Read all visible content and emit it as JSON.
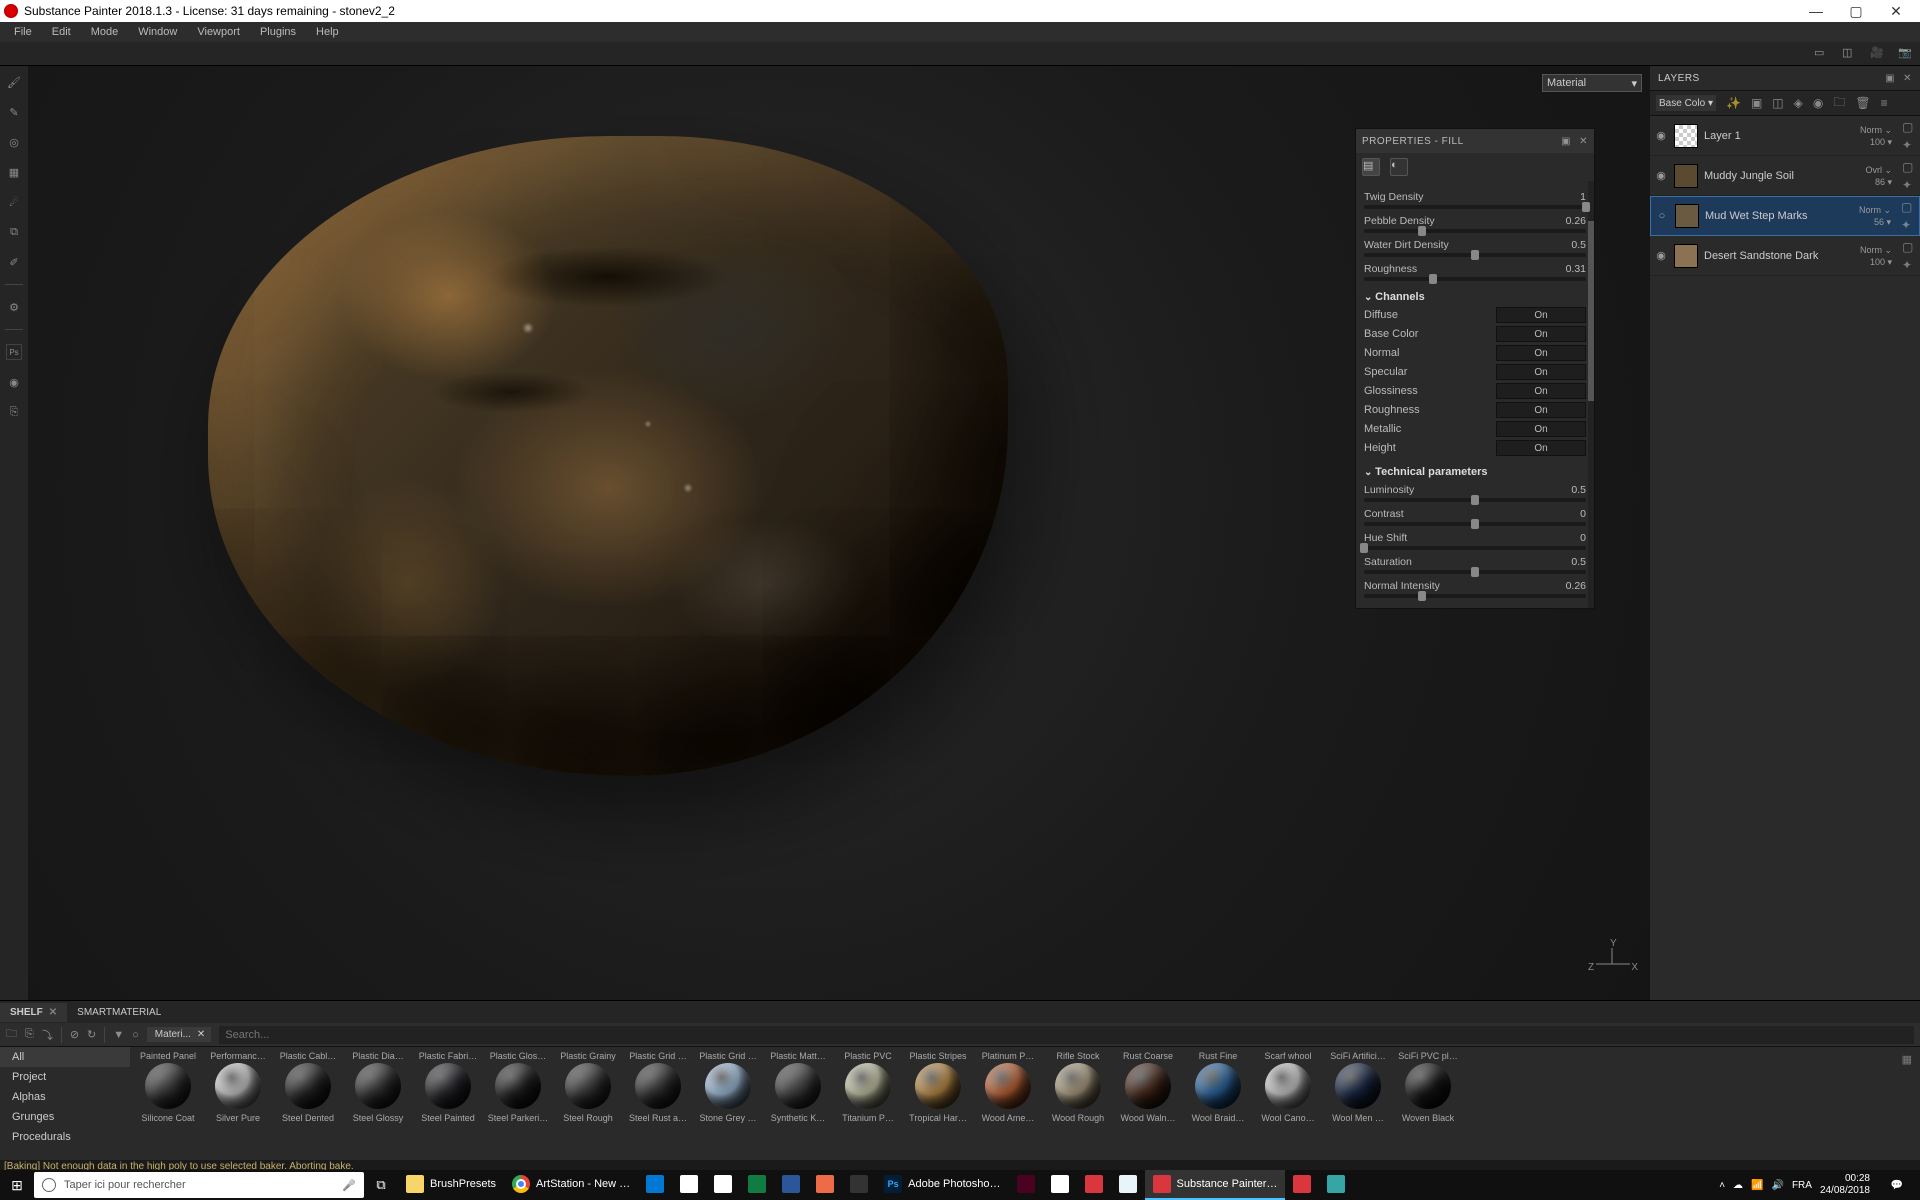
{
  "title": "Substance Painter 2018.1.3 - License: 31 days remaining - stonev2_2",
  "menu": [
    "File",
    "Edit",
    "Mode",
    "Window",
    "Viewport",
    "Plugins",
    "Help"
  ],
  "viewport": {
    "mode": "Material",
    "axes": {
      "x": "X",
      "y": "Y",
      "z": "Z"
    }
  },
  "properties": {
    "title": "PROPERTIES - FILL",
    "sliders": [
      {
        "label": "Twig Density",
        "value": "1",
        "pos": 100
      },
      {
        "label": "Pebble Density",
        "value": "0.26",
        "pos": 26
      },
      {
        "label": "Water Dirt Density",
        "value": "0.5",
        "pos": 50
      },
      {
        "label": "Roughness",
        "value": "0.31",
        "pos": 31
      }
    ],
    "channels_h": "Channels",
    "channels": [
      {
        "label": "Diffuse",
        "state": "On"
      },
      {
        "label": "Base Color",
        "state": "On"
      },
      {
        "label": "Normal",
        "state": "On"
      },
      {
        "label": "Specular",
        "state": "On"
      },
      {
        "label": "Glossiness",
        "state": "On"
      },
      {
        "label": "Roughness",
        "state": "On"
      },
      {
        "label": "Metallic",
        "state": "On"
      },
      {
        "label": "Height",
        "state": "On"
      }
    ],
    "tech_h": "Technical parameters",
    "tech": [
      {
        "label": "Luminosity",
        "value": "0.5",
        "pos": 50
      },
      {
        "label": "Contrast",
        "value": "0",
        "pos": 50
      },
      {
        "label": "Hue Shift",
        "value": "0",
        "pos": 0
      },
      {
        "label": "Saturation",
        "value": "0.5",
        "pos": 50
      },
      {
        "label": "Normal Intensity",
        "value": "0.26",
        "pos": 26
      }
    ]
  },
  "layers": {
    "title": "LAYERS",
    "channel_sel": "Base Colo",
    "items": [
      {
        "name": "Layer 1",
        "blend": "Norm",
        "opacity": "100",
        "thumb": "#eee",
        "checker": true
      },
      {
        "name": "Muddy Jungle Soil",
        "blend": "Ovrl",
        "opacity": "86",
        "thumb": "#5a4a32"
      },
      {
        "name": "Mud Wet Step Marks",
        "blend": "Norm",
        "opacity": "56",
        "thumb": "#6b5a42",
        "selected": true,
        "eyeoff": true
      },
      {
        "name": "Desert Sandstone Dark",
        "blend": "Norm",
        "opacity": "100",
        "thumb": "#8a7252"
      }
    ]
  },
  "shelf": {
    "tabs": [
      {
        "label": "SHELF",
        "close": true,
        "active": true
      },
      {
        "label": "SMARTMATERIAL"
      }
    ],
    "chip": "Materi...",
    "search_ph": "Search...",
    "cats": [
      "All",
      "Project",
      "Alphas",
      "Grunges",
      "Procedurals"
    ],
    "items_top": [
      "Painted Panel",
      "Performanc…",
      "Plastic Cabl…",
      "Plastic Dia…",
      "Plastic Fabri…",
      "Plastic Glos…",
      "Plastic Grainy",
      "Plastic Grid …",
      "Plastic Grid …",
      "Plastic Matt…",
      "Plastic PVC",
      "Plastic Stripes",
      "Platinum P…",
      "Rifle Stock",
      "Rust Coarse",
      "Rust Fine",
      "Scarf whool",
      "SciFi Artifici…",
      "SciFi PVC pl…"
    ],
    "items_bot": [
      "Silicone Coat",
      "Silver Pure",
      "Steel Dented",
      "Steel Glossy",
      "Steel Painted",
      "Steel Parkeri…",
      "Steel Rough",
      "Steel Rust a…",
      "Stone Grey …",
      "Synthetic K…",
      "Titanium P…",
      "Tropical Har…",
      "Wood Ame…",
      "Wood Rough",
      "Wood Waln…",
      "Wool Braid…",
      "Wool Cano…",
      "Wool Men …",
      "Woven Black"
    ],
    "colors": [
      "#3a3a3a",
      "#d8d8d8",
      "#2a2a2a",
      "#333",
      "#2a2a30",
      "#222",
      "#3a3a3a",
      "#333",
      "#a8c8e8",
      "#444",
      "#d0d0b0",
      "#c8954a",
      "#c86838",
      "#b8a888",
      "#4a2a1a",
      "#2a6aa8",
      "#d8d8d8",
      "#1a2a4a",
      "#1a1a1a"
    ]
  },
  "status": "[Baking] Not enough data in the high poly to use selected baker. Aborting bake.",
  "taskbar": {
    "search_ph": "Taper ici pour rechercher",
    "apps": [
      {
        "label": "BrushPresets",
        "color": "#f8d568"
      },
      {
        "label": "ArtStation - New …",
        "color": "#fff",
        "chrome": true
      },
      {
        "label": "",
        "color": "#0078d4"
      },
      {
        "label": "",
        "color": "#fff"
      },
      {
        "label": "",
        "color": "#fff"
      },
      {
        "label": "",
        "color": "#107c41"
      },
      {
        "label": "",
        "color": "#2b579a"
      },
      {
        "label": "",
        "color": "#ed6c47"
      },
      {
        "label": "",
        "color": "#333"
      },
      {
        "label": "Adobe Photosho…",
        "color": "#001e36",
        "ps": true
      },
      {
        "label": "",
        "color": "#49021f"
      },
      {
        "label": "",
        "color": "#fff"
      },
      {
        "label": "",
        "color": "#d9363e"
      },
      {
        "label": "",
        "color": "#e8f4f8"
      },
      {
        "label": "Substance Painter…",
        "color": "#d9363e",
        "active": true
      },
      {
        "label": "",
        "color": "#d9363e"
      },
      {
        "label": "",
        "color": "#36a5a5"
      }
    ],
    "time": "00:28",
    "date": "24/08/2018"
  }
}
